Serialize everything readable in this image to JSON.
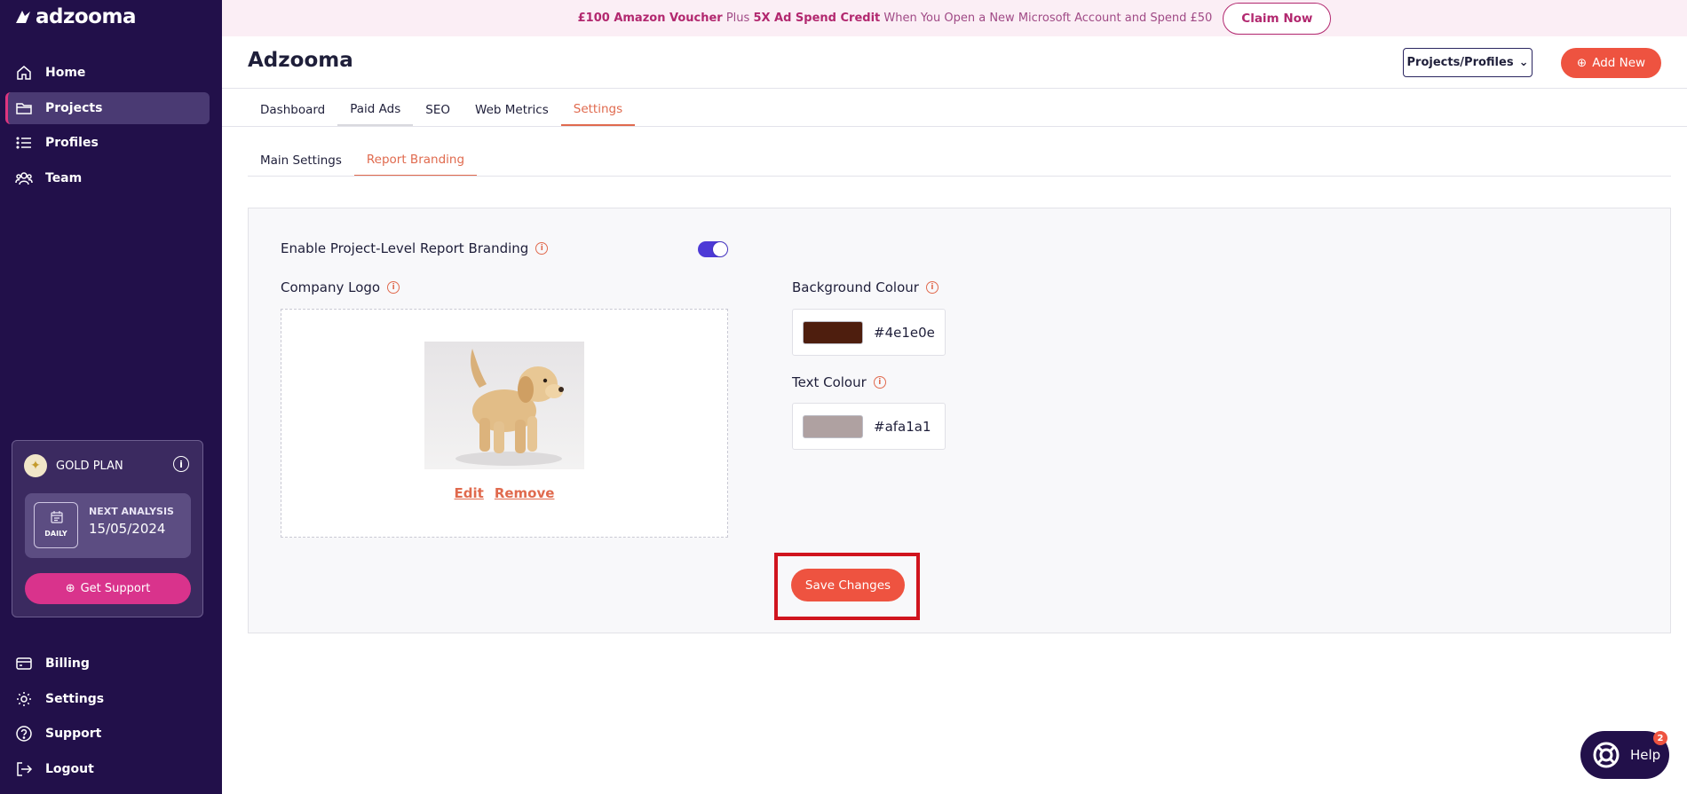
{
  "brand": {
    "logo_text": "adzooma"
  },
  "sidebar": {
    "items": [
      {
        "label": "Home",
        "icon": "home-icon"
      },
      {
        "label": "Projects",
        "icon": "folder-icon",
        "active": true
      },
      {
        "label": "Profiles",
        "icon": "list-icon"
      },
      {
        "label": "Team",
        "icon": "team-icon"
      }
    ],
    "bottom_items": [
      {
        "label": "Billing",
        "icon": "billing-icon"
      },
      {
        "label": "Settings",
        "icon": "gear-icon"
      },
      {
        "label": "Support",
        "icon": "help-circle-icon"
      },
      {
        "label": "Logout",
        "icon": "logout-icon"
      }
    ],
    "plan": {
      "name": "GOLD PLAN",
      "analysis_label": "NEXT ANALYSIS",
      "analysis_date": "15/05/2024",
      "frequency": "DAILY",
      "support_label": "Get Support"
    }
  },
  "promo": {
    "part1": "£100 Amazon Voucher",
    "part2": " Plus ",
    "part3": "5X Ad Spend Credit",
    "part4": " When You Open a New Microsoft Account and Spend £50",
    "cta": "Claim Now"
  },
  "header": {
    "title": "Adzooma",
    "select_label": "Projects/Profiles",
    "add_new_label": "Add New"
  },
  "tabs": [
    {
      "label": "Dashboard"
    },
    {
      "label": "Paid Ads"
    },
    {
      "label": "SEO"
    },
    {
      "label": "Web Metrics"
    },
    {
      "label": "Settings",
      "active": true
    }
  ],
  "subtabs": [
    {
      "label": "Main Settings"
    },
    {
      "label": "Report Branding",
      "active": true
    }
  ],
  "branding": {
    "enable_label": "Enable Project-Level Report Branding",
    "enabled": true,
    "logo_label": "Company Logo",
    "edit_label": "Edit",
    "remove_label": "Remove",
    "bg_label": "Background Colour",
    "bg_value": "#4e1e0e",
    "text_label": "Text Colour",
    "text_value": "#afa1a1",
    "save_label": "Save Changes"
  },
  "help": {
    "label": "Help",
    "badge": "2"
  },
  "colors": {
    "sidebar_bg": "#22104a",
    "accent": "#ee5340",
    "active_tab": "#e06a4e",
    "toggle": "#4d3ad6",
    "support_btn": "#d9338c"
  }
}
